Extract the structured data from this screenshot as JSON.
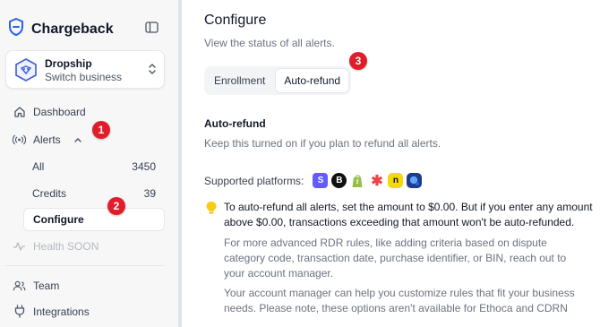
{
  "brand": {
    "name": "Chargeback"
  },
  "business": {
    "name": "Dropship",
    "action": "Switch business"
  },
  "nav": {
    "dashboard": "Dashboard",
    "alerts": "Alerts",
    "alerts_sub": [
      {
        "label": "All",
        "count": "3450"
      },
      {
        "label": "Credits",
        "count": "39"
      },
      {
        "label": "Configure",
        "count": ""
      }
    ],
    "health": "Health SOON",
    "team": "Team",
    "integrations": "Integrations"
  },
  "badges": {
    "b1": "1",
    "b2": "2",
    "b3": "3"
  },
  "main": {
    "title": "Configure",
    "subtitle": "View the status of all alerts.",
    "tabs": [
      "Enrollment",
      "Auto-refund"
    ],
    "section_title": "Auto-refund",
    "section_sub": "Keep this turned on if you plan to refund all alerts.",
    "platforms_label": "Supported platforms:",
    "tip": "To auto-refund all alerts, set the amount to $0.00. But if you enter any amount above $0.00, transactions exceeding that amount won't be auto-refunded.",
    "note1": "For more advanced RDR rules, like adding criteria based on dispute category code, transaction date, purchase identifier, or BIN, reach out to your account manager.",
    "note2": "Your account manager can help you customize rules that fit your business needs. Please note, these options aren't available for Ethoca and CDRN"
  },
  "colors": {
    "accent": "#2563eb",
    "badge": "#e11d2a"
  },
  "platform_icons": [
    {
      "name": "stripe-icon",
      "glyph": "S",
      "color": "#635bff"
    },
    {
      "name": "b-platform-icon",
      "glyph": "B",
      "color": "#111111"
    },
    {
      "name": "shopify-icon",
      "glyph": "S",
      "color": "#95bf47"
    },
    {
      "name": "puzzle-platform-icon",
      "glyph": "✱",
      "color": "#ef4444"
    },
    {
      "name": "n-platform-icon",
      "glyph": "n",
      "color": "#e6c700"
    },
    {
      "name": "blue-platform-icon",
      "glyph": "●",
      "color": "#1d4ed8"
    }
  ]
}
